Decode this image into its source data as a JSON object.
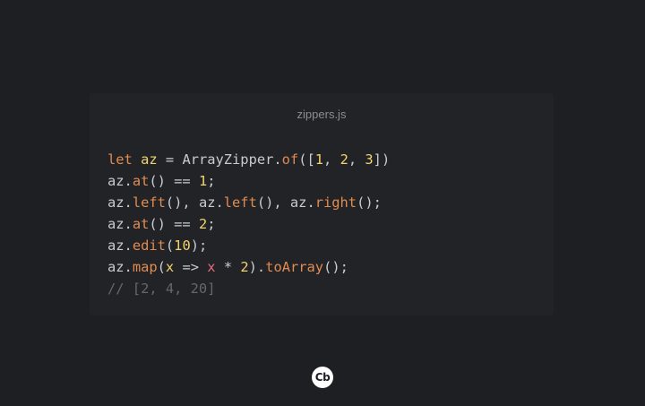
{
  "card": {
    "filename": "zippers.js"
  },
  "code": {
    "line1": {
      "kw": "let",
      "sp1": " ",
      "var": "az",
      "rest1": " = ArrayZipper.",
      "fn": "of",
      "rest2": "([",
      "n1": "1",
      "c1": ", ",
      "n2": "2",
      "c2": ", ",
      "n3": "3",
      "end": "])"
    },
    "line2": {
      "obj": "az.",
      "fn": "at",
      "mid": "() == ",
      "num": "1",
      "end": ";"
    },
    "line3": {
      "obj1": "az.",
      "fn1": "left",
      "mid1": "(), az.",
      "fn2": "left",
      "mid2": "(), az.",
      "fn3": "right",
      "end": "();"
    },
    "line4": {
      "obj": "az.",
      "fn": "at",
      "mid": "() == ",
      "num": "2",
      "end": ";"
    },
    "line5": {
      "obj": "az.",
      "fn": "edit",
      "open": "(",
      "num": "10",
      "end": ");"
    },
    "line6": {
      "obj": "az.",
      "fn": "map",
      "open": "(",
      "param": "x",
      "arrow": " => ",
      "ref": "x",
      "op": " * ",
      "num": "2",
      "mid": ").",
      "fn2": "toArray",
      "end": "();"
    },
    "line7": {
      "comment": "// [2, 4, 20]"
    }
  },
  "logo": {
    "text": "Cb"
  },
  "colors": {
    "background": "#1e1f23",
    "card": "#222327",
    "keyword": "#e28b50",
    "number": "#f3d36d",
    "reference": "#e86a7a",
    "comment": "#65676d",
    "text": "#c9cbd1"
  }
}
